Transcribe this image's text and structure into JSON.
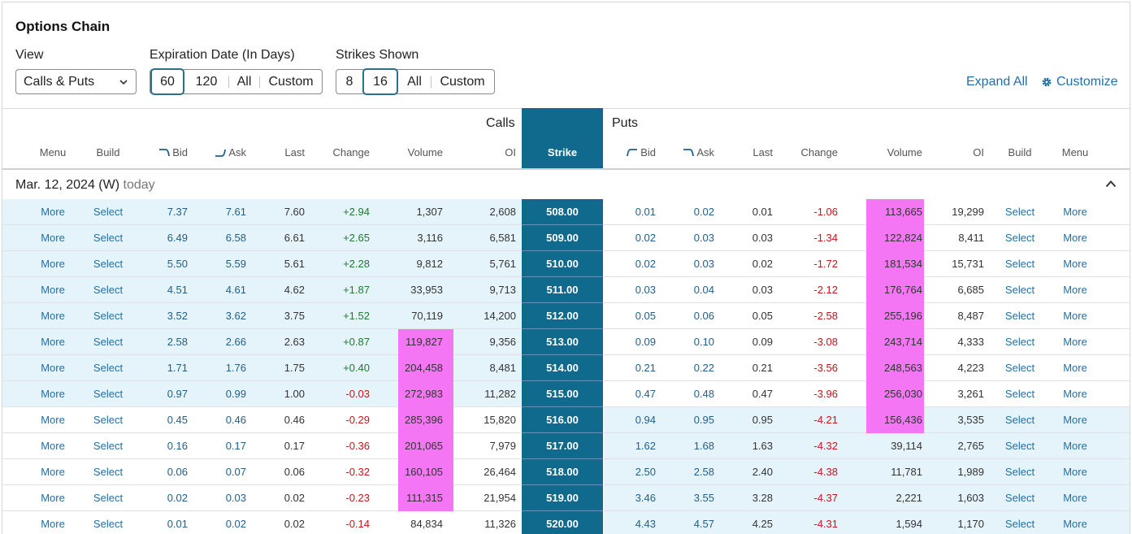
{
  "header": {
    "title": "Options Chain",
    "view_label": "View",
    "view_value": "Calls & Puts",
    "expiration_label": "Expiration Date (In Days)",
    "expiration_options": [
      "60",
      "120",
      "All",
      "Custom"
    ],
    "expiration_selected": "60",
    "strikes_label": "Strikes Shown",
    "strikes_options": [
      "8",
      "16",
      "All",
      "Custom"
    ],
    "strikes_selected": "16",
    "expand_all": "Expand All",
    "customize": "Customize"
  },
  "table": {
    "calls_label": "Calls",
    "puts_label": "Puts",
    "columns": {
      "menu": "Menu",
      "build": "Build",
      "bid": "Bid",
      "ask": "Ask",
      "last": "Last",
      "change": "Change",
      "volume": "Volume",
      "oi": "OI",
      "strike": "Strike"
    },
    "expiration_group": {
      "date": "Mar. 12, 2024 (W)",
      "suffix": "today"
    },
    "link_more": "More",
    "link_select": "Select",
    "rows": [
      {
        "call": {
          "bid": "7.37",
          "ask": "7.61",
          "last": "7.60",
          "change": "+2.94",
          "volume": "1,307",
          "oi": "2,608"
        },
        "strike": "508.00",
        "put": {
          "bid": "0.01",
          "ask": "0.02",
          "last": "0.01",
          "change": "-1.06",
          "volume": "113,665",
          "oi": "19,299"
        }
      },
      {
        "call": {
          "bid": "6.49",
          "ask": "6.58",
          "last": "6.61",
          "change": "+2.65",
          "volume": "3,116",
          "oi": "6,581"
        },
        "strike": "509.00",
        "put": {
          "bid": "0.02",
          "ask": "0.03",
          "last": "0.03",
          "change": "-1.34",
          "volume": "122,824",
          "oi": "8,411"
        }
      },
      {
        "call": {
          "bid": "5.50",
          "ask": "5.59",
          "last": "5.61",
          "change": "+2.28",
          "volume": "9,812",
          "oi": "5,761"
        },
        "strike": "510.00",
        "put": {
          "bid": "0.02",
          "ask": "0.03",
          "last": "0.02",
          "change": "-1.72",
          "volume": "181,534",
          "oi": "15,731"
        }
      },
      {
        "call": {
          "bid": "4.51",
          "ask": "4.61",
          "last": "4.62",
          "change": "+1.87",
          "volume": "33,953",
          "oi": "9,713"
        },
        "strike": "511.00",
        "put": {
          "bid": "0.03",
          "ask": "0.04",
          "last": "0.03",
          "change": "-2.12",
          "volume": "176,764",
          "oi": "6,685"
        }
      },
      {
        "call": {
          "bid": "3.52",
          "ask": "3.62",
          "last": "3.75",
          "change": "+1.52",
          "volume": "70,119",
          "oi": "14,200"
        },
        "strike": "512.00",
        "put": {
          "bid": "0.05",
          "ask": "0.06",
          "last": "0.05",
          "change": "-2.58",
          "volume": "255,196",
          "oi": "8,487"
        }
      },
      {
        "call": {
          "bid": "2.58",
          "ask": "2.66",
          "last": "2.63",
          "change": "+0.87",
          "volume": "119,827",
          "oi": "9,356"
        },
        "strike": "513.00",
        "put": {
          "bid": "0.09",
          "ask": "0.10",
          "last": "0.09",
          "change": "-3.08",
          "volume": "243,714",
          "oi": "4,333"
        }
      },
      {
        "call": {
          "bid": "1.71",
          "ask": "1.76",
          "last": "1.75",
          "change": "+0.40",
          "volume": "204,458",
          "oi": "8,481"
        },
        "strike": "514.00",
        "put": {
          "bid": "0.21",
          "ask": "0.22",
          "last": "0.21",
          "change": "-3.56",
          "volume": "248,563",
          "oi": "4,223"
        }
      },
      {
        "call": {
          "bid": "0.97",
          "ask": "0.99",
          "last": "1.00",
          "change": "-0.03",
          "volume": "272,983",
          "oi": "11,282"
        },
        "strike": "515.00",
        "put": {
          "bid": "0.47",
          "ask": "0.48",
          "last": "0.47",
          "change": "-3.96",
          "volume": "256,030",
          "oi": "3,261"
        }
      },
      {
        "call": {
          "bid": "0.45",
          "ask": "0.46",
          "last": "0.46",
          "change": "-0.29",
          "volume": "285,396",
          "oi": "15,820"
        },
        "strike": "516.00",
        "put": {
          "bid": "0.94",
          "ask": "0.95",
          "last": "0.95",
          "change": "-4.21",
          "volume": "156,436",
          "oi": "3,535"
        }
      },
      {
        "call": {
          "bid": "0.16",
          "ask": "0.17",
          "last": "0.17",
          "change": "-0.36",
          "volume": "201,065",
          "oi": "7,979"
        },
        "strike": "517.00",
        "put": {
          "bid": "1.62",
          "ask": "1.68",
          "last": "1.63",
          "change": "-4.32",
          "volume": "39,114",
          "oi": "2,765"
        }
      },
      {
        "call": {
          "bid": "0.06",
          "ask": "0.07",
          "last": "0.06",
          "change": "-0.32",
          "volume": "160,105",
          "oi": "26,464"
        },
        "strike": "518.00",
        "put": {
          "bid": "2.50",
          "ask": "2.58",
          "last": "2.40",
          "change": "-4.38",
          "volume": "11,781",
          "oi": "1,989"
        }
      },
      {
        "call": {
          "bid": "0.02",
          "ask": "0.03",
          "last": "0.02",
          "change": "-0.23",
          "volume": "111,315",
          "oi": "21,954"
        },
        "strike": "519.00",
        "put": {
          "bid": "3.46",
          "ask": "3.55",
          "last": "3.28",
          "change": "-4.37",
          "volume": "2,221",
          "oi": "1,603"
        }
      },
      {
        "call": {
          "bid": "0.01",
          "ask": "0.02",
          "last": "0.02",
          "change": "-0.14",
          "volume": "84,834",
          "oi": "11,326"
        },
        "strike": "520.00",
        "put": {
          "bid": "4.43",
          "ask": "4.57",
          "last": "4.25",
          "change": "-4.31",
          "volume": "1,594",
          "oi": "1,170"
        }
      }
    ],
    "call_in_the_money_rows": 8,
    "put_in_the_money_from_row": 8,
    "call_volume_highlight_rows": [
      5,
      6,
      7,
      8,
      9,
      10,
      11
    ],
    "put_volume_highlight_rows": [
      0,
      1,
      2,
      3,
      4,
      5,
      6,
      7,
      8
    ],
    "colors": {
      "strike_bg": "#0f6a8e",
      "itm_shade": "#e5f4fb",
      "volume_highlight": "#f476f4",
      "link": "#1f6fa8",
      "positive": "#1f7a2e",
      "negative": "#c4161c"
    }
  }
}
